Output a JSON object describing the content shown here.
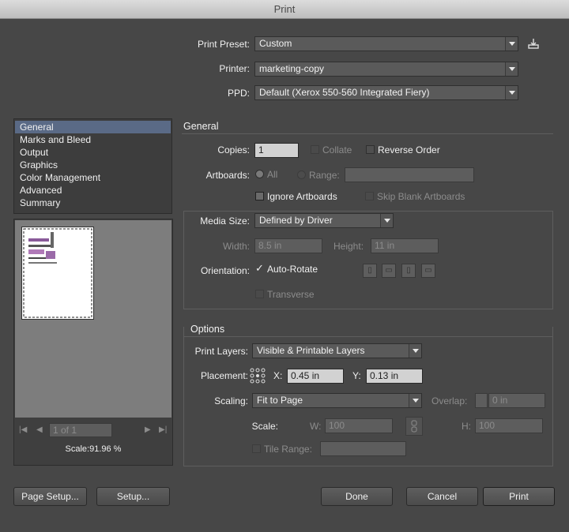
{
  "window": {
    "title": "Print"
  },
  "top": {
    "preset_label": "Print Preset:",
    "preset_value": "Custom",
    "printer_label": "Printer:",
    "printer_value": "marketing-copy",
    "ppd_label": "PPD:",
    "ppd_value": "Default (Xerox 550-560 Integrated Fiery)"
  },
  "sidebar": {
    "items": [
      {
        "label": "General",
        "selected": true
      },
      {
        "label": "Marks and Bleed"
      },
      {
        "label": "Output"
      },
      {
        "label": "Graphics"
      },
      {
        "label": "Color Management"
      },
      {
        "label": "Advanced"
      },
      {
        "label": "Summary"
      }
    ]
  },
  "preview": {
    "page_indicator": "1 of 1",
    "scale": "Scale:91.96 %"
  },
  "general": {
    "heading": "General",
    "copies_label": "Copies:",
    "copies_value": "1",
    "collate_label": "Collate",
    "reverse_label": "Reverse Order",
    "artboards_label": "Artboards:",
    "all_label": "All",
    "range_label": "Range:",
    "ignore_label": "Ignore Artboards",
    "skip_label": "Skip Blank Artboards"
  },
  "media": {
    "size_label": "Media Size:",
    "size_value": "Defined by Driver",
    "width_label": "Width:",
    "width_value": "8.5 in",
    "height_label": "Height:",
    "height_value": "11 in",
    "orientation_label": "Orientation:",
    "autorotate_label": "Auto-Rotate",
    "transverse_label": "Transverse"
  },
  "options": {
    "heading": "Options",
    "layers_label": "Print Layers:",
    "layers_value": "Visible & Printable Layers",
    "placement_label": "Placement:",
    "x_label": "X:",
    "x_value": "0.45 in",
    "y_label": "Y:",
    "y_value": "0.13 in",
    "scaling_label": "Scaling:",
    "scaling_value": "Fit to Page",
    "overlap_label": "Overlap:",
    "overlap_value": "0 in",
    "scale_label": "Scale:",
    "w_label": "W:",
    "w_value": "100",
    "h_label": "H:",
    "h_value": "100",
    "tile_label": "Tile Range:"
  },
  "buttons": {
    "page_setup": "Page Setup...",
    "setup": "Setup...",
    "done": "Done",
    "cancel": "Cancel",
    "print": "Print"
  }
}
